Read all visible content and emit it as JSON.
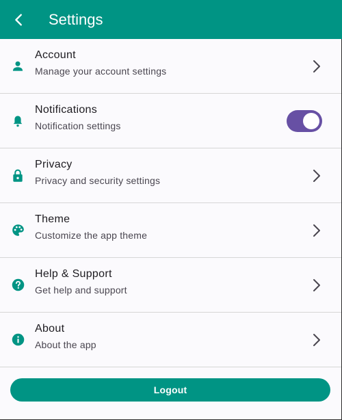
{
  "colors": {
    "primary": "#009484",
    "switch_on": "#6750a4",
    "background": "#fbfafd",
    "divider": "#d6d6d6"
  },
  "appbar": {
    "title": "Settings",
    "back_icon": "arrow-back-icon"
  },
  "items": [
    {
      "icon": "person-icon",
      "title": "Account",
      "subtitle": "Manage your account settings",
      "trailing": "chevron-right-icon"
    },
    {
      "icon": "bell-icon",
      "title": "Notifications",
      "subtitle": "Notification settings",
      "trailing": "switch",
      "switch_on": true
    },
    {
      "icon": "lock-icon",
      "title": "Privacy",
      "subtitle": "Privacy and security settings",
      "trailing": "chevron-right-icon"
    },
    {
      "icon": "palette-icon",
      "title": "Theme",
      "subtitle": "Customize the app theme",
      "trailing": "chevron-right-icon"
    },
    {
      "icon": "help-icon",
      "title": "Help & Support",
      "subtitle": "Get help and support",
      "trailing": "chevron-right-icon"
    },
    {
      "icon": "info-icon",
      "title": "About",
      "subtitle": "About the app",
      "trailing": "chevron-right-icon"
    }
  ],
  "logout": {
    "label": "Logout"
  }
}
